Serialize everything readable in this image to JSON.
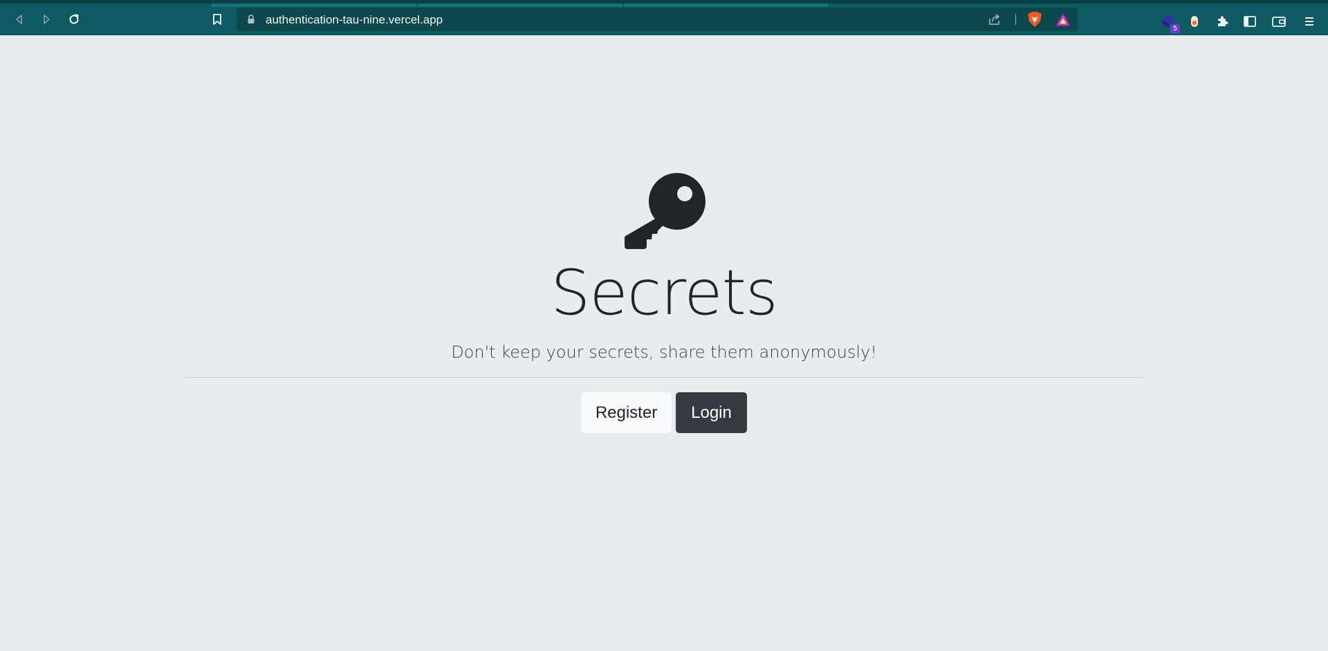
{
  "browser": {
    "url": "authentication-tau-nine.vercel.app",
    "extension_badge": "5",
    "colors": {
      "toolbar": "#0e5a62",
      "address_bar": "#0d474e"
    },
    "icons": [
      "back-icon",
      "forward-icon",
      "reload-icon",
      "bookmark-icon",
      "lock-icon",
      "share-icon",
      "brave-shields-icon",
      "brave-rewards-icon",
      "extension-icon",
      "extension-toggle-icon",
      "extensions-puzzle-icon",
      "sidebar-icon",
      "wallet-icon",
      "menu-icon"
    ]
  },
  "page": {
    "title": "Secrets",
    "lead": "Don't keep your secrets, share them anonymously!",
    "register_label": "Register",
    "login_label": "Login",
    "icon": "key-icon",
    "colors": {
      "background": "#e8ecef",
      "text": "#212529",
      "register_button": "#f8f9fa",
      "login_button": "#343a40"
    }
  }
}
